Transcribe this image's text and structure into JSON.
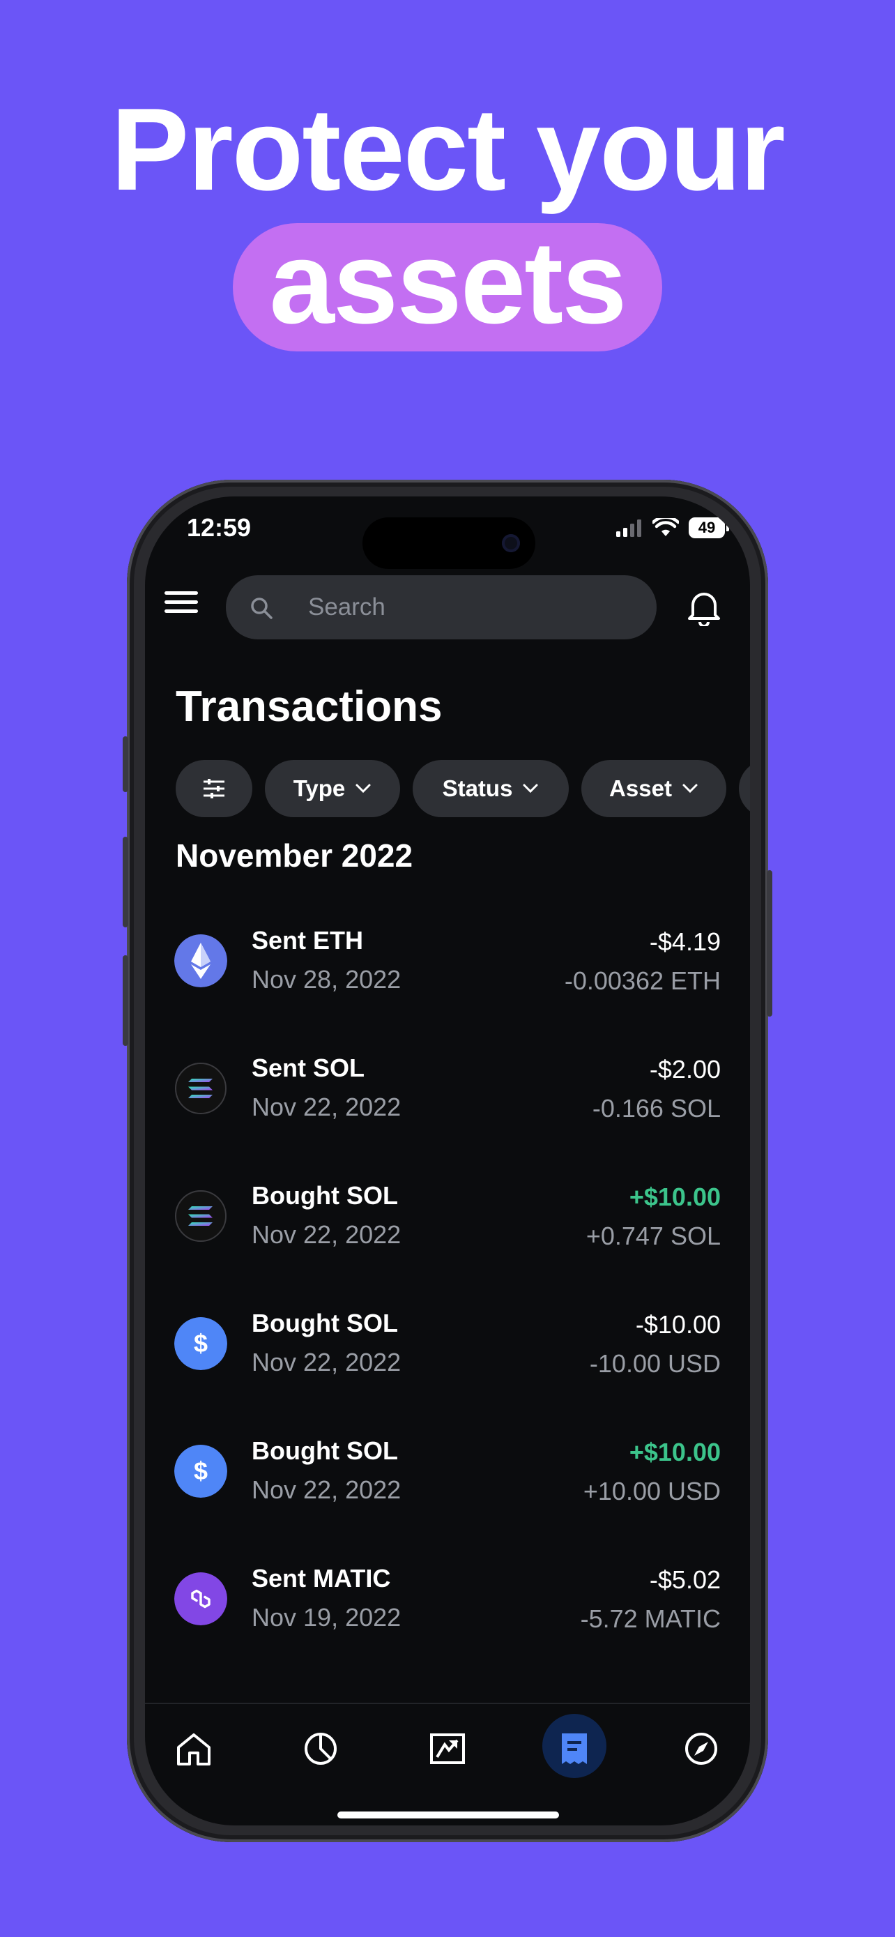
{
  "hero": {
    "line1": "Protect your",
    "line2": "assets"
  },
  "status_bar": {
    "time": "12:59",
    "battery": "49"
  },
  "search": {
    "placeholder": "Search"
  },
  "page": {
    "title": "Transactions"
  },
  "filters": {
    "type": "Type",
    "status": "Status",
    "asset": "Asset"
  },
  "section": {
    "month": "November 2022"
  },
  "transactions": [
    {
      "name": "Sent ETH",
      "date": "Nov 28, 2022",
      "amount": "-$4.19",
      "sub": "-0.00362 ETH",
      "positive": false,
      "icon": "eth-icon"
    },
    {
      "name": "Sent SOL",
      "date": "Nov 22, 2022",
      "amount": "-$2.00",
      "sub": "-0.166 SOL",
      "positive": false,
      "icon": "sol-icon"
    },
    {
      "name": "Bought SOL",
      "date": "Nov 22, 2022",
      "amount": "+$10.00",
      "sub": "+0.747 SOL",
      "positive": true,
      "icon": "sol-icon"
    },
    {
      "name": "Bought SOL",
      "date": "Nov 22, 2022",
      "amount": "-$10.00",
      "sub": "-10.00 USD",
      "positive": false,
      "icon": "usd-icon"
    },
    {
      "name": "Bought SOL",
      "date": "Nov 22, 2022",
      "amount": "+$10.00",
      "sub": "+10.00 USD",
      "positive": true,
      "icon": "usd-icon"
    },
    {
      "name": "Sent MATIC",
      "date": "Nov 19, 2022",
      "amount": "-$5.02",
      "sub": "-5.72 MATIC",
      "positive": false,
      "icon": "matic-icon"
    }
  ],
  "colors": {
    "background": "#6B55F7",
    "pill": "#C36FF2",
    "positive": "#3CC48B",
    "usd": "#4F86F7",
    "eth": "#6378E8",
    "matic": "#8247E5",
    "nav_active": "#0E2550"
  },
  "nav": [
    "home-icon",
    "portfolio-icon",
    "trade-icon",
    "transactions-icon",
    "explore-icon"
  ]
}
